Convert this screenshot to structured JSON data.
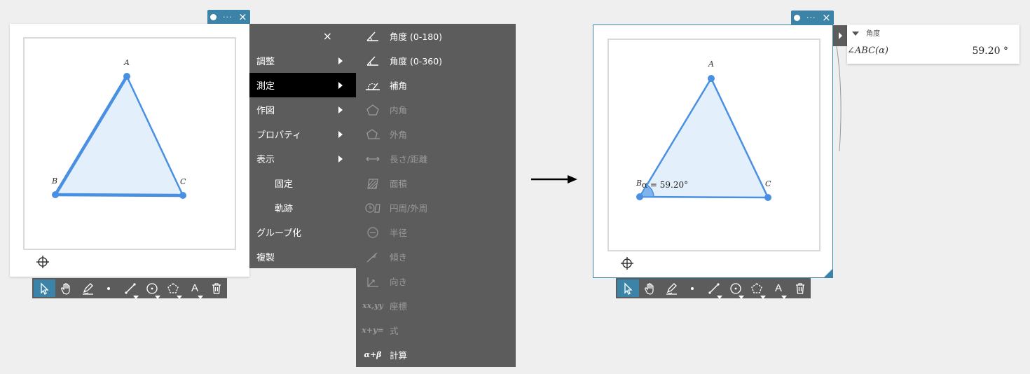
{
  "context_menu": {
    "close_icon": "×",
    "items": [
      {
        "label": "調整",
        "submenu": true
      },
      {
        "label": "測定",
        "submenu": true,
        "selected": true
      },
      {
        "label": "作図",
        "submenu": true
      },
      {
        "label": "プロパティ",
        "submenu": true
      },
      {
        "label": "表示",
        "submenu": true
      },
      {
        "label": "固定",
        "indent": true
      },
      {
        "label": "軌跡",
        "indent": true
      },
      {
        "label": "グループ化"
      },
      {
        "label": "複製"
      }
    ]
  },
  "measure_submenu": {
    "items": [
      {
        "label": "角度 (0-180)",
        "icon": "angle-icon",
        "enabled": true
      },
      {
        "label": "角度 (0-360)",
        "icon": "angle-360-icon",
        "enabled": true
      },
      {
        "label": "補角",
        "icon": "supplementary-angle-icon",
        "enabled": true
      },
      {
        "label": "内角",
        "icon": "interior-angle-icon",
        "enabled": false
      },
      {
        "label": "外角",
        "icon": "exterior-angle-icon",
        "enabled": false
      },
      {
        "label": "長さ/距離",
        "icon": "length-icon",
        "enabled": false
      },
      {
        "label": "面積",
        "icon": "area-icon",
        "enabled": false
      },
      {
        "label": "円周/外周",
        "icon": "perimeter-icon",
        "enabled": false
      },
      {
        "label": "半径",
        "icon": "radius-icon",
        "enabled": false
      },
      {
        "label": "傾き",
        "icon": "slope-icon",
        "enabled": false
      },
      {
        "label": "向き",
        "icon": "direction-icon",
        "enabled": false
      },
      {
        "label": "座標",
        "icon": "coordinates-icon",
        "glyph": "xx,yy",
        "enabled": false
      },
      {
        "label": "式",
        "icon": "equation-icon",
        "glyph": "x+y=",
        "enabled": false
      },
      {
        "label": "計算",
        "icon": "calculate-icon",
        "glyph": "α+β",
        "enabled": true
      }
    ]
  },
  "figure": {
    "vertex_labels": {
      "a": "A",
      "b": "B",
      "c": "C"
    },
    "angle_annotation": "α = 59.20°"
  },
  "panel_tab": {
    "more": "···",
    "close": "×"
  },
  "toolbar": {
    "tools": [
      {
        "name": "select-tool",
        "active": true
      },
      {
        "name": "pan-tool"
      },
      {
        "name": "pen-tool"
      },
      {
        "name": "point-tool"
      },
      {
        "name": "line-tool",
        "sub": true
      },
      {
        "name": "circle-tool",
        "sub": true
      },
      {
        "name": "polygon-tool",
        "sub": true
      },
      {
        "name": "text-tool",
        "label": "A",
        "sub": true
      },
      {
        "name": "delete-tool"
      }
    ]
  },
  "measurement_panel": {
    "header": "角度",
    "label": "∠ABC(α)",
    "value": "59.20 °"
  },
  "colors": {
    "accent": "#3b84a8",
    "shape": "#4a90e2",
    "fill": "#e3effb",
    "menu": "#5c5c5c"
  }
}
